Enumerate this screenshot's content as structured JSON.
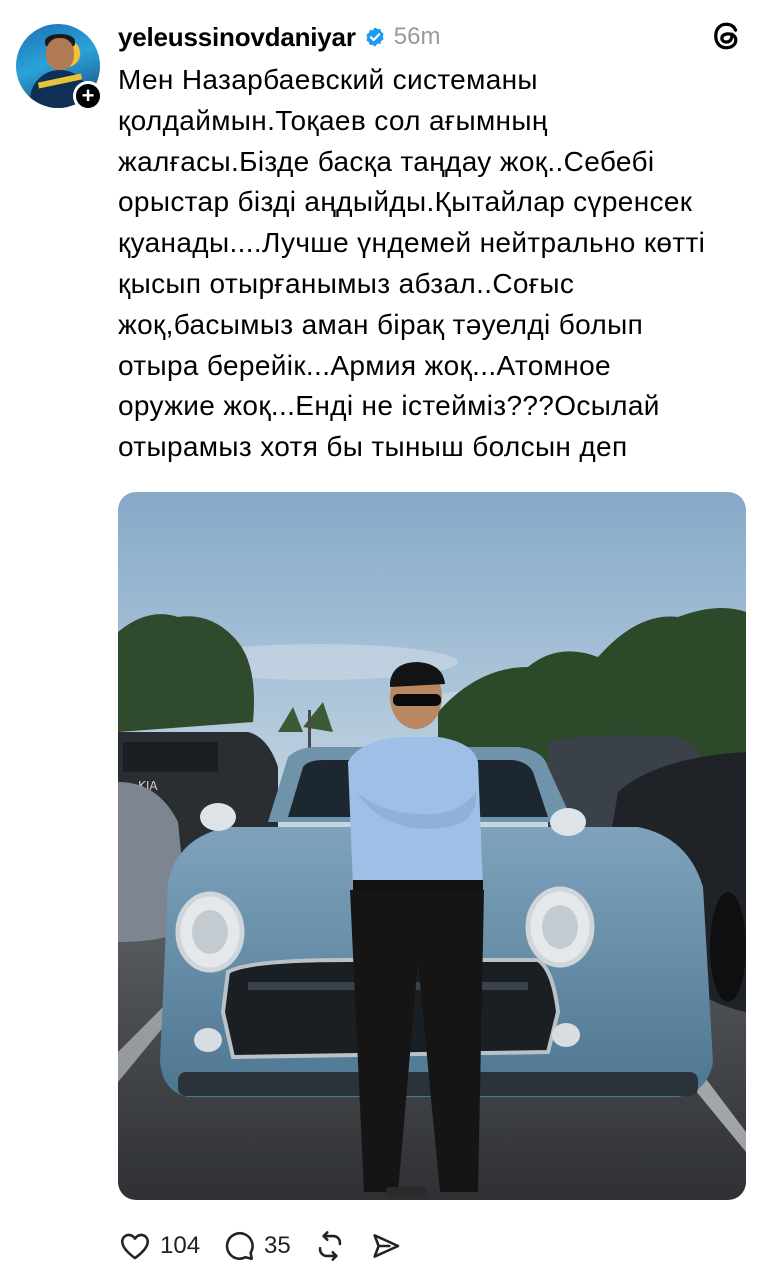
{
  "post": {
    "username": "yeleussinovdaniyar",
    "time": "56m",
    "text": "Мен Назарбаевский системаны\nқолдаймын.Тоқаев сол ағымның\nжалғасы.Бізде басқа таңдау жоқ..Себебі\nорыстар бізді аңдыйды.Қытайлар сүренсек\nқуанады....Лучше үндемей нейтрально көтті\nқысып отырғанымыз абзал..Соғыс\nжоқ,басымыз аман бірақ тәуелді болып\nотыра берейік...Армия жоқ...Атомное\nоружие жоқ...Енді не істейміз???Осылай\nотырамыз хотя бы тыныш болсын деп",
    "verified_color": "#1d9bf0"
  },
  "actions": {
    "likes": "104",
    "replies": "35"
  },
  "icons": {
    "app": "threads-icon",
    "like": "heart-icon",
    "reply": "comment-icon",
    "repost": "repost-icon",
    "share": "send-icon"
  }
}
